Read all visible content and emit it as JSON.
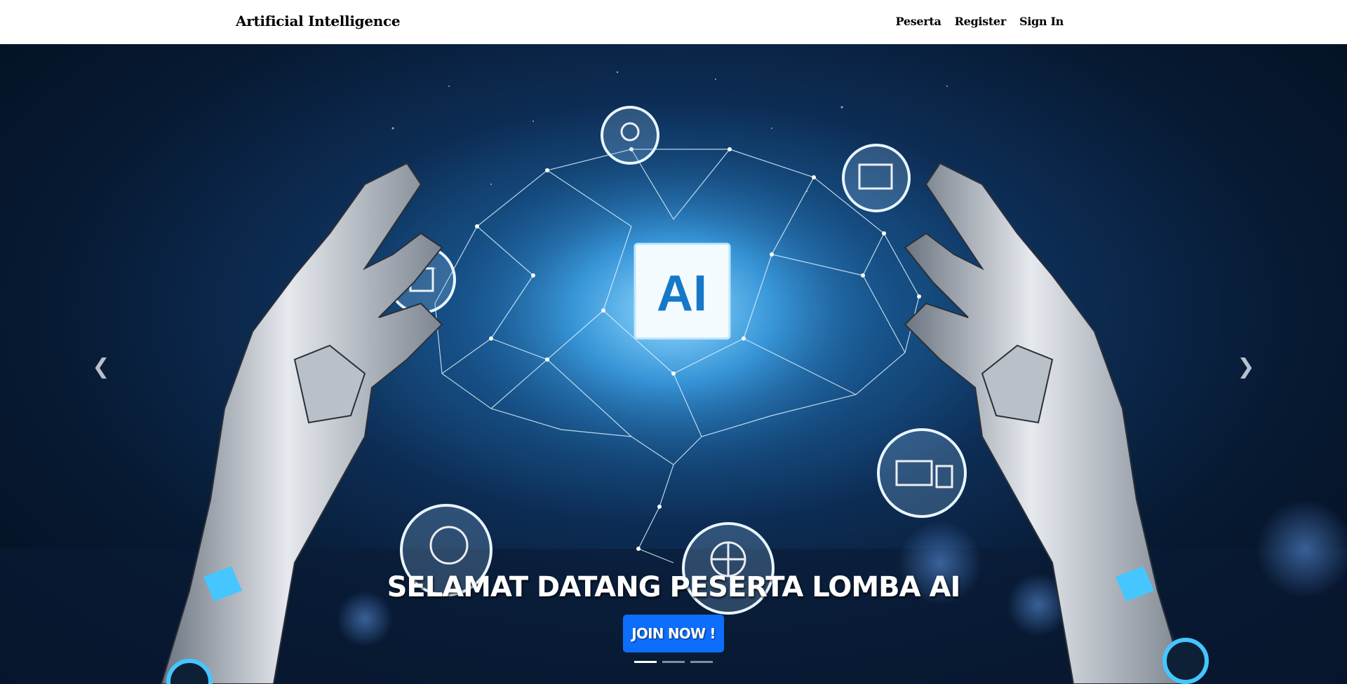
{
  "navbar": {
    "brand": "Artificial Intelligence",
    "links": [
      {
        "label": "Peserta"
      },
      {
        "label": "Register"
      },
      {
        "label": "Sign In"
      }
    ]
  },
  "hero": {
    "center_logo_text": "AI",
    "caption_title": "SELAMAT DATANG PESERTA LOMBA AI",
    "cta_label": "JOIN NOW !",
    "controls": {
      "prev_icon": "chevron-left-icon",
      "next_icon": "chevron-right-icon"
    },
    "slides_count": 3,
    "active_slide": 1
  },
  "colors": {
    "button": "#0d6efd",
    "hero_background": "#071a33",
    "glow": "#3fa0e0"
  }
}
